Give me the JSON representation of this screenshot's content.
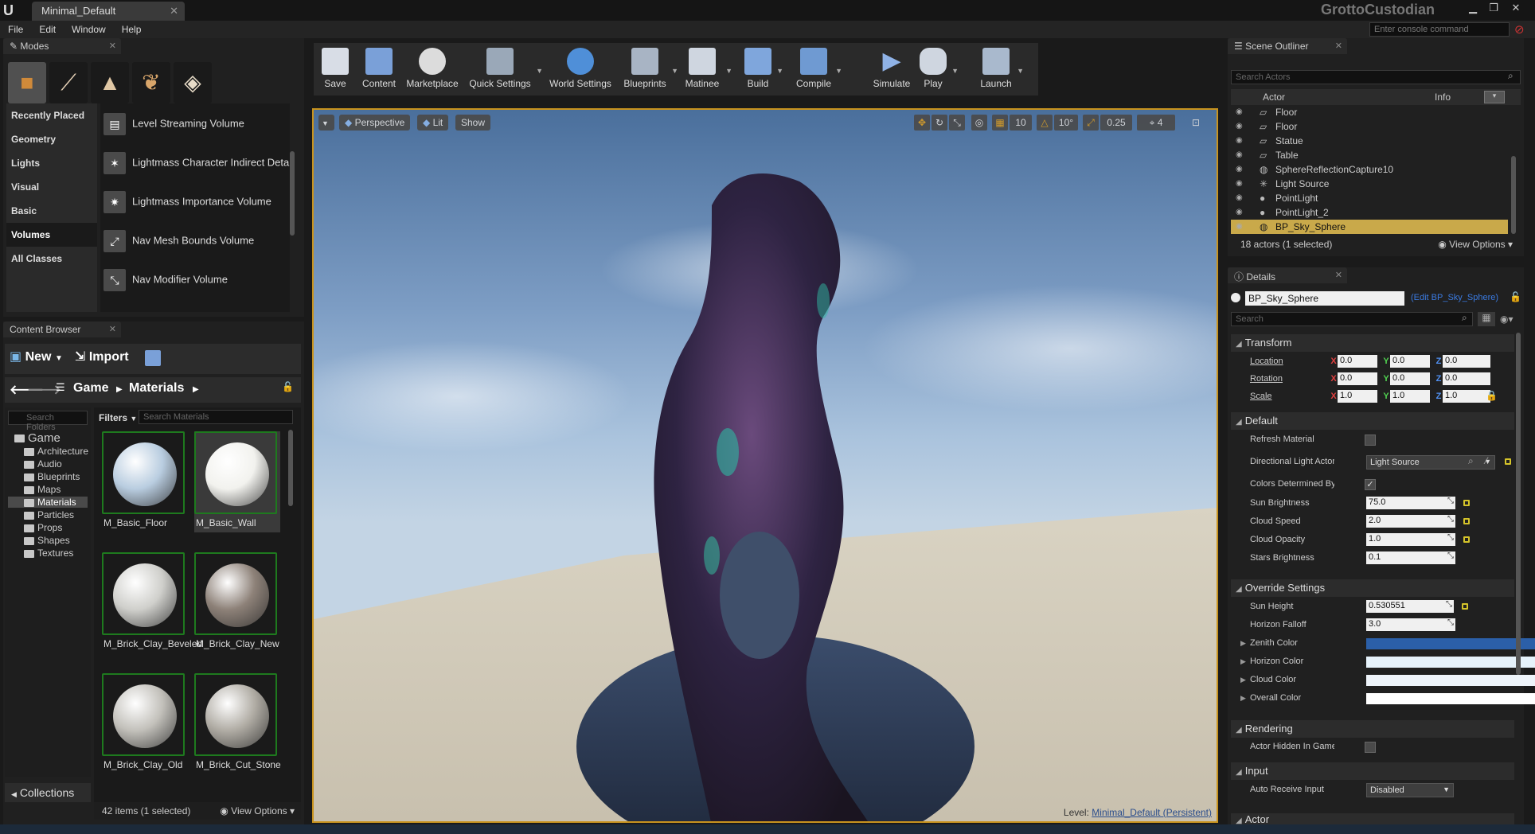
{
  "titlebar": {
    "tab": "Minimal_Default",
    "project": "GrottoCustodian",
    "console_placeholder": "Enter console command"
  },
  "menu": [
    "File",
    "Edit",
    "Window",
    "Help"
  ],
  "modes": {
    "tab": "Modes",
    "categories": [
      "Recently Placed",
      "Geometry",
      "Lights",
      "Visual",
      "Basic",
      "Volumes",
      "All Classes"
    ],
    "active_category": "Volumes",
    "items": [
      {
        "label": "Level Streaming Volume"
      },
      {
        "label": "Lightmass Character Indirect Detail Volume"
      },
      {
        "label": "Lightmass Importance Volume"
      },
      {
        "label": "Nav Mesh Bounds Volume"
      },
      {
        "label": "Nav Modifier Volume"
      }
    ]
  },
  "content_browser": {
    "tab": "Content Browser",
    "new_label": "New",
    "import_label": "Import",
    "path": [
      "Game",
      "Materials"
    ],
    "tree_search_placeholder": "Search Folders",
    "tree": [
      "Game",
      "Architecture",
      "Audio",
      "Blueprints",
      "Maps",
      "Materials",
      "Particles",
      "Props",
      "Shapes",
      "Textures"
    ],
    "filters_label": "Filters",
    "search_placeholder": "Search Materials",
    "assets": [
      {
        "name": "M_Basic_Floor",
        "color": "#b9cde0"
      },
      {
        "name": "M_Basic_Wall",
        "color": "#f2f2ee"
      },
      {
        "name": "M_Brick_Clay_Beveled",
        "color": "#cfcfcb"
      },
      {
        "name": "M_Brick_Clay_New",
        "color": "#8d8178"
      },
      {
        "name": "M_Brick_Clay_Old",
        "color": "#c2c0ba"
      },
      {
        "name": "M_Brick_Cut_Stone",
        "color": "#b0aca4"
      }
    ],
    "status": "42 items (1 selected)",
    "view_options": "View Options",
    "collections": "Collections"
  },
  "toolbar": [
    {
      "label": "Save",
      "color": "#d8dde6"
    },
    {
      "label": "Content",
      "color": "#7aa0d8"
    },
    {
      "label": "Marketplace",
      "color": "#dcdcdc"
    },
    {
      "label": "Quick Settings",
      "color": "#9aa8b8"
    },
    {
      "label": "World Settings",
      "color": "#4f8fd8"
    },
    {
      "label": "Blueprints",
      "color": "#a8b4c4"
    },
    {
      "label": "Matinee",
      "color": "#cfd6e0"
    },
    {
      "label": "Build",
      "color": "#7fa6dc"
    },
    {
      "label": "Compile",
      "color": "#6f9ad2"
    },
    {
      "label": "Simulate",
      "color": "#8fb2e6"
    },
    {
      "label": "Play",
      "color": "#cfd6e0"
    },
    {
      "label": "Launch",
      "color": "#a9b9cd"
    }
  ],
  "viewport": {
    "perspective": "Perspective",
    "lit": "Lit",
    "show": "Show",
    "grid_snap": "10",
    "rot_snap": "10°",
    "scale_snap": "0.25",
    "camera_speed": "4",
    "level_label": "Level:",
    "level_name": "Minimal_Default (Persistent)"
  },
  "outliner": {
    "tab": "Scene Outliner",
    "search_placeholder": "Search Actors",
    "col_actor": "Actor",
    "col_info": "Info",
    "rows": [
      {
        "name": "Floor",
        "icon": "mesh-icon"
      },
      {
        "name": "Floor",
        "icon": "mesh-icon"
      },
      {
        "name": "Statue",
        "icon": "mesh-icon"
      },
      {
        "name": "Table",
        "icon": "mesh-icon"
      },
      {
        "name": "SphereReflectionCapture10",
        "icon": "sphere-icon"
      },
      {
        "name": "Light Source",
        "icon": "sun-icon"
      },
      {
        "name": "PointLight",
        "icon": "bulb-icon"
      },
      {
        "name": "PointLight_2",
        "icon": "bulb-icon"
      },
      {
        "name": "BP_Sky_Sphere",
        "icon": "sphere-icon"
      }
    ],
    "selected": "BP_Sky_Sphere",
    "status": "18 actors (1 selected)",
    "view_options": "View Options"
  },
  "details": {
    "tab": "Details",
    "name": "BP_Sky_Sphere",
    "edit_link": "(Edit BP_Sky_Sphere)",
    "search_placeholder": "Search",
    "transform": {
      "title": "Transform",
      "location_label": "Location",
      "rotation_label": "Rotation",
      "scale_label": "Scale",
      "location": [
        "0.0",
        "0.0",
        "0.0"
      ],
      "rotation": [
        "0.0",
        "0.0",
        "0.0"
      ],
      "scale": [
        "1.0",
        "1.0",
        "1.0"
      ]
    },
    "default": {
      "title": "Default",
      "refresh_material": "Refresh Material",
      "directional_light": "Directional Light Actor",
      "directional_light_value": "Light Source",
      "colors_determined": "Colors Determined By Sun Position",
      "sun_brightness": "Sun Brightness",
      "sun_brightness_value": "75.0",
      "cloud_speed": "Cloud Speed",
      "cloud_speed_value": "2.0",
      "cloud_opacity": "Cloud Opacity",
      "cloud_opacity_value": "1.0",
      "stars_brightness": "Stars Brightness",
      "stars_brightness_value": "0.1"
    },
    "override": {
      "title": "Override Settings",
      "sun_height": "Sun Height",
      "sun_height_value": "0.530551",
      "horizon_falloff": "Horizon Falloff",
      "horizon_falloff_value": "3.0",
      "zenith_color": "Zenith Color",
      "horizon_color": "Horizon Color",
      "cloud_color": "Cloud Color",
      "overall_color": "Overall Color",
      "colors": {
        "zenith": "#2b5fa8",
        "horizon": "#e6f2fb",
        "cloud": "#eef4fa",
        "overall": "#ffffff"
      }
    },
    "rendering": {
      "title": "Rendering",
      "actor_hidden": "Actor Hidden In Game"
    },
    "input": {
      "title": "Input",
      "auto_receive": "Auto Receive Input",
      "auto_receive_value": "Disabled"
    },
    "actor_title": "Actor"
  }
}
